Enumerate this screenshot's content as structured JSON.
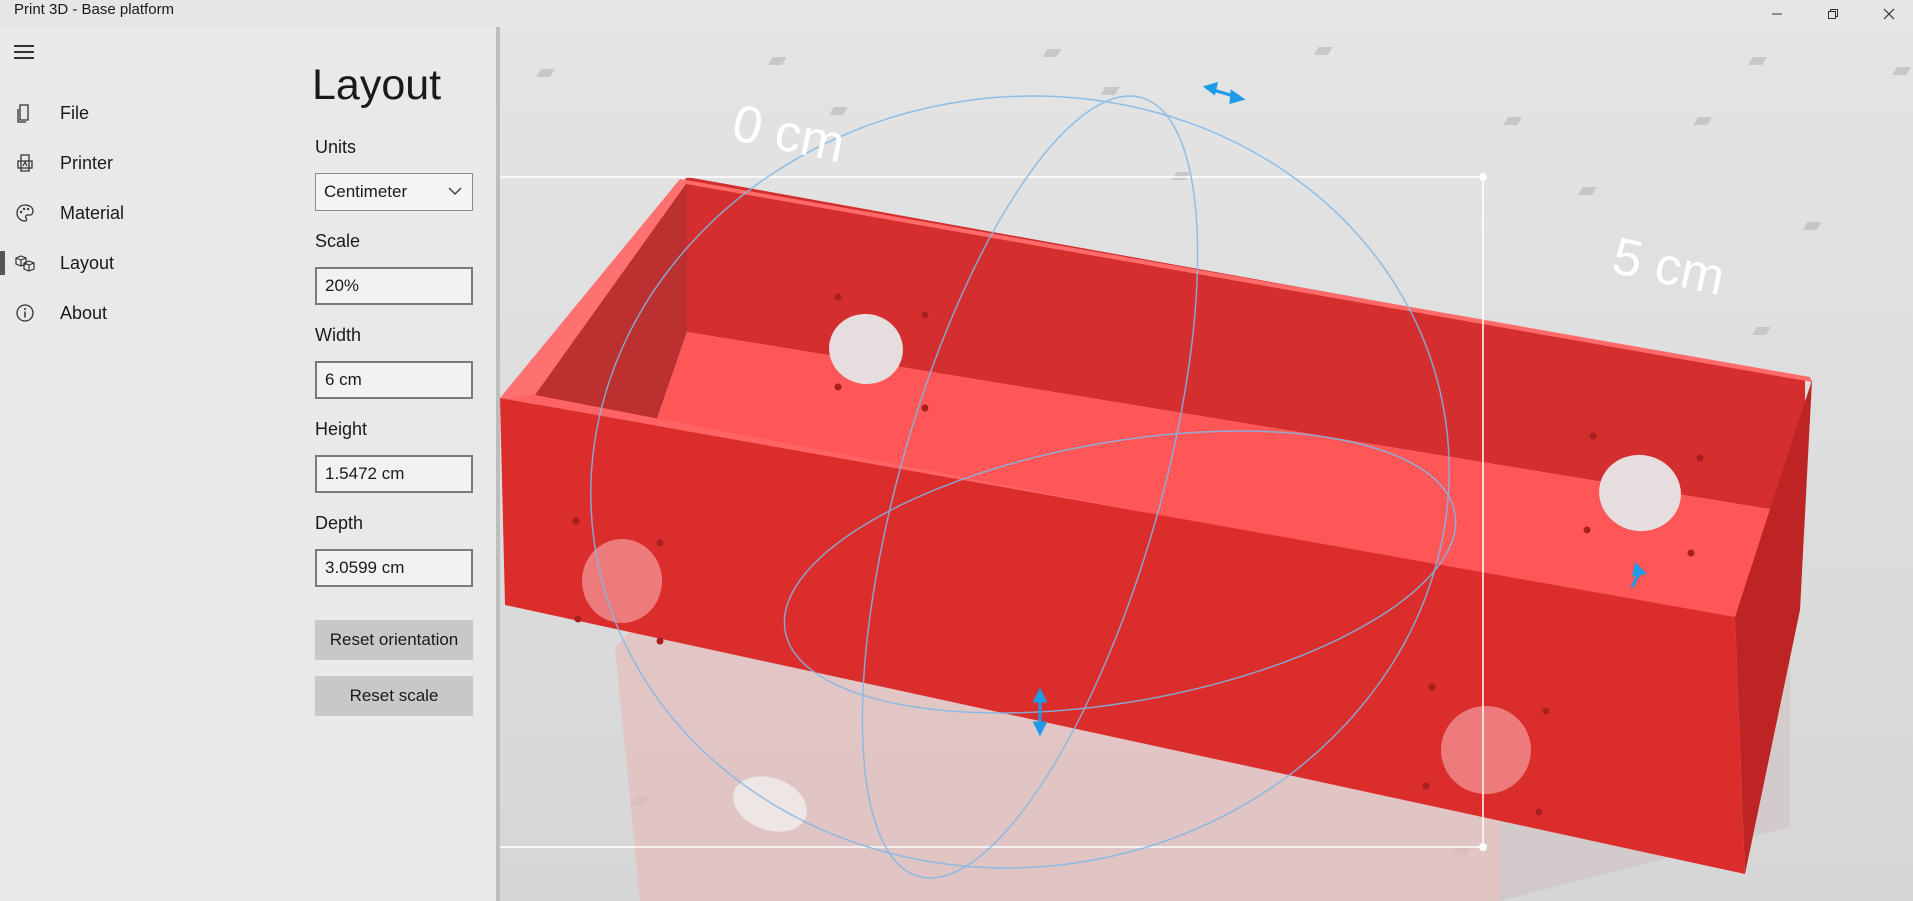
{
  "window": {
    "title": "Print 3D - Base platform",
    "controls": [
      "minimize-icon",
      "maximize-icon",
      "close-icon"
    ]
  },
  "nav": {
    "menu_icon": "hamburger-icon",
    "items": [
      {
        "label": "File",
        "icon": "file-icon"
      },
      {
        "label": "Printer",
        "icon": "printer-icon"
      },
      {
        "label": "Material",
        "icon": "palette-icon"
      },
      {
        "label": "Layout",
        "icon": "cubes-icon",
        "active": true
      },
      {
        "label": "About",
        "icon": "info-icon"
      }
    ]
  },
  "layout_panel": {
    "title": "Layout",
    "units": {
      "label": "Units",
      "value": "Centimeter"
    },
    "scale": {
      "label": "Scale",
      "value": "20%"
    },
    "width": {
      "label": "Width",
      "value": "6 cm"
    },
    "height": {
      "label": "Height",
      "value": "1.5472 cm"
    },
    "depth": {
      "label": "Depth",
      "value": "3.0599 cm"
    },
    "reset_orientation": "Reset orientation",
    "reset_scale": "Reset scale"
  },
  "viewport": {
    "ruler_labels": [
      "0 cm",
      "5 cm"
    ],
    "model_color": "#d42a2a",
    "gizmo_color": "#1e9be8"
  }
}
